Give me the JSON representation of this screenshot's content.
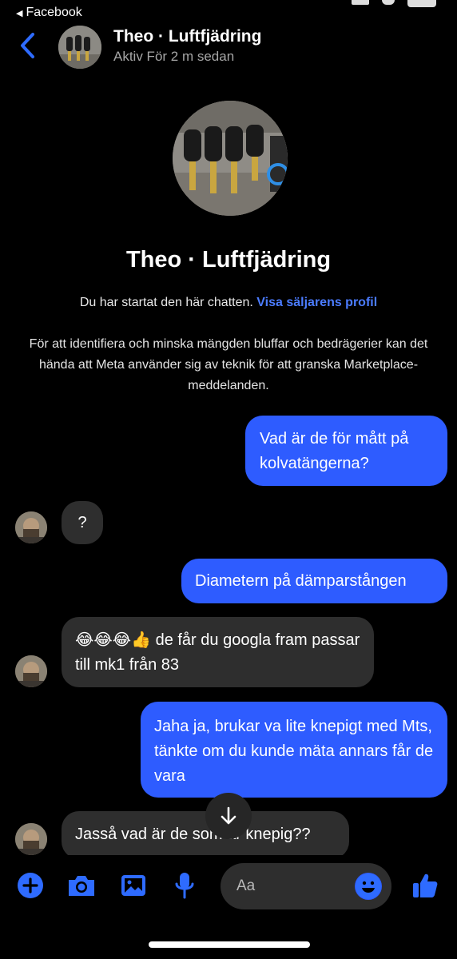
{
  "status_bar": {
    "back_app_label": "Facebook"
  },
  "header": {
    "name": "Theo · Luftfjädring",
    "status": "Aktiv För 2 m sedan"
  },
  "profile": {
    "name": "Theo · Luftfjädring",
    "started_text": "Du har startat den här chatten.",
    "seller_profile_link": "Visa säljarens profil",
    "disclaimer": "För att identifiera och minska mängden bluffar och bedrägerier kan det hända att Meta använder sig av teknik för att granska Marketplace-meddelanden."
  },
  "messages": [
    {
      "direction": "out",
      "text": "Vad är de för mått på kolvatängerna?"
    },
    {
      "direction": "in",
      "text": "?"
    },
    {
      "direction": "out",
      "text": "Diametern på dämparstången"
    },
    {
      "direction": "in",
      "text": "😂😂😂👍 de får du googla fram passar till mk1 från 83"
    },
    {
      "direction": "out",
      "text": "Jaha ja, brukar va lite knepigt med Mts, tänkte om du kunde mäta annars får de vara"
    },
    {
      "direction": "in",
      "text": "Jasså vad är de som är knepig??"
    }
  ],
  "composer": {
    "placeholder": "Aa"
  },
  "colors": {
    "accent": "#2e5cff",
    "incoming_bubble": "#2e2e2e",
    "background": "#000000",
    "link": "#4b7cff"
  },
  "icons": [
    "back-chevron-icon",
    "plus-icon",
    "camera-icon",
    "image-icon",
    "microphone-icon",
    "emoji-icon",
    "thumbs-up-icon",
    "arrow-down-icon"
  ]
}
